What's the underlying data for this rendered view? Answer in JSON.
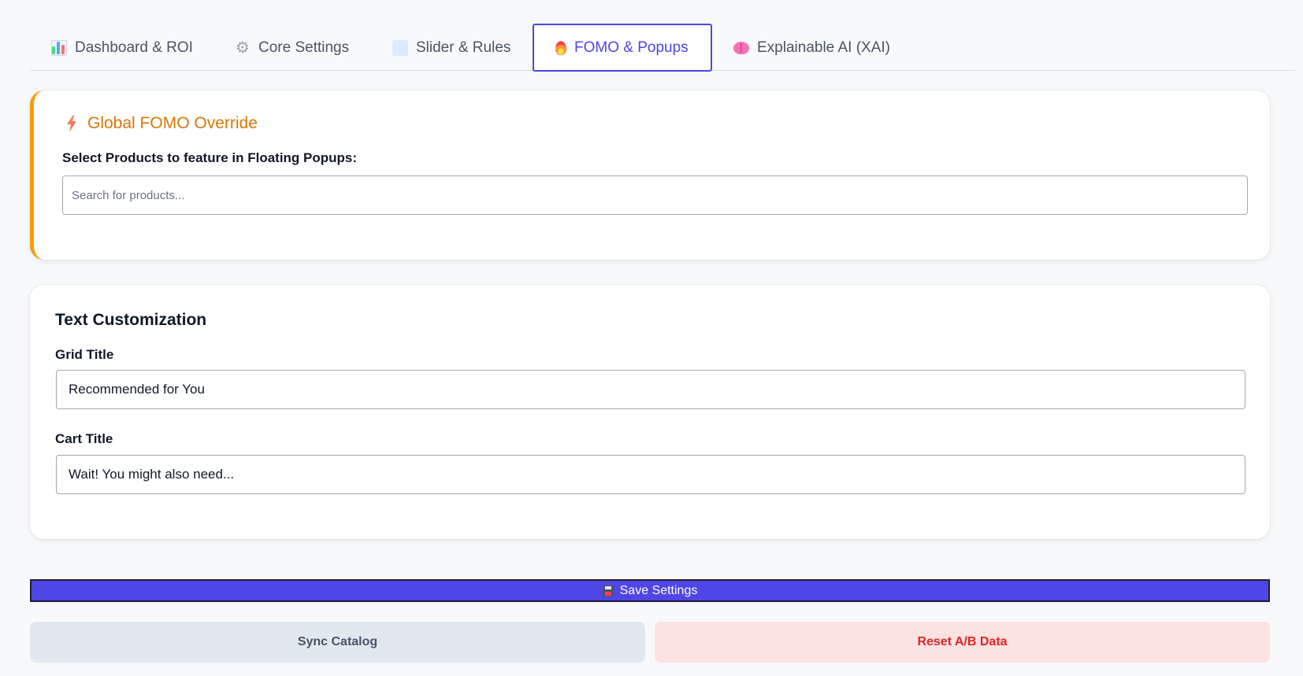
{
  "tabs": [
    {
      "label": "Dashboard & ROI",
      "icon": "bar-chart-icon"
    },
    {
      "label": "Core Settings",
      "icon": "gear-icon"
    },
    {
      "label": "Slider & Rules",
      "icon": "grid-icon"
    },
    {
      "label": "FOMO & Popups",
      "icon": "fire-icon",
      "active": true
    },
    {
      "label": "Explainable AI (XAI)",
      "icon": "brain-icon"
    }
  ],
  "fomo": {
    "title": "Global FOMO Override",
    "select_label": "Select Products to feature in Floating Popups:",
    "search_placeholder": "Search for products...",
    "accent_color": "#f59e0b"
  },
  "text_customization": {
    "title": "Text Customization",
    "grid_title_label": "Grid Title",
    "grid_title_value": "Recommended for You",
    "cart_title_label": "Cart Title",
    "cart_title_value": "Wait! You might also need..."
  },
  "actions": {
    "save_label": "Save Settings",
    "sync_label": "Sync Catalog",
    "reset_label": "Reset A/B Data"
  },
  "colors": {
    "primary": "#4f46e5",
    "fomo_title": "#d97706",
    "danger": "#dc2626",
    "danger_bg": "#fde2e2",
    "neutral_bg": "#e2e8f0"
  }
}
